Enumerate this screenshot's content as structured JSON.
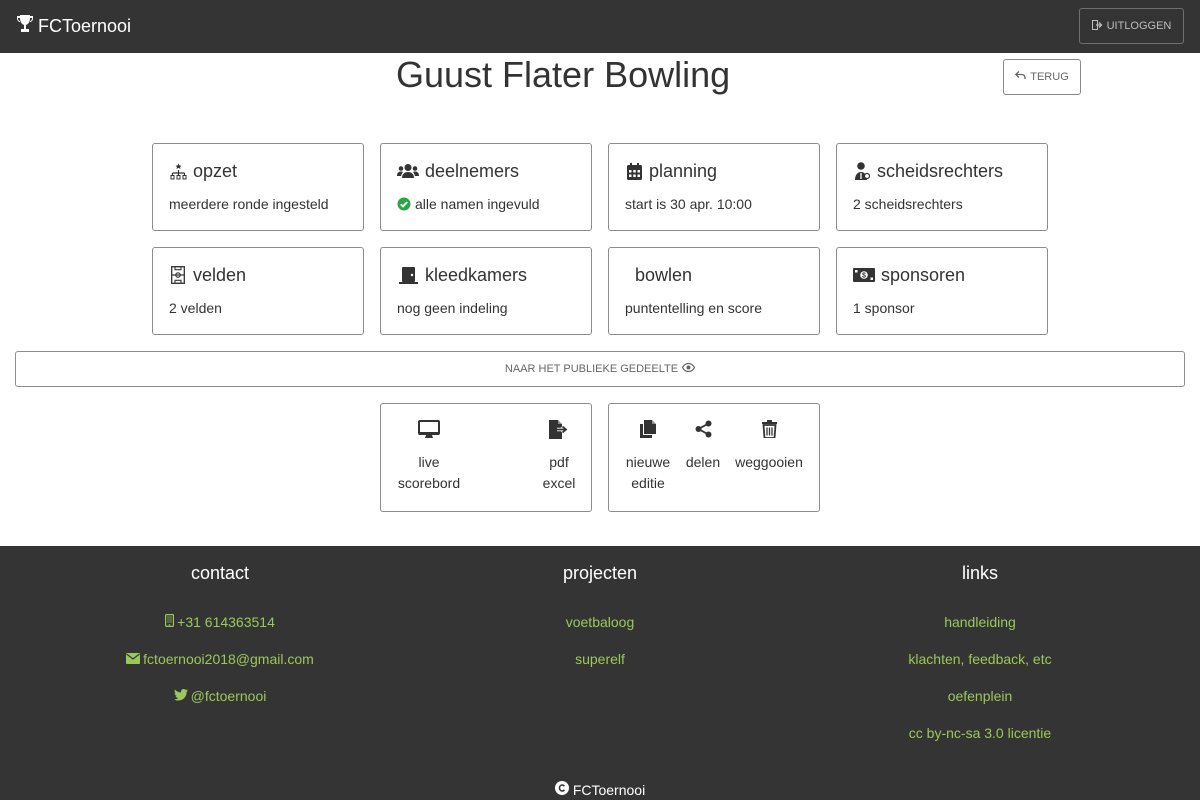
{
  "app": {
    "brand": "FCToernooi",
    "logout_label": "uitloggen"
  },
  "tournament": {
    "title": "Guust Flater Bowling",
    "back_label": "terug"
  },
  "cards": [
    {
      "title": "opzet",
      "subtitle": "meerdere ronde ingesteld",
      "icon": "sitemap-icon"
    },
    {
      "title": "deelnemers",
      "subtitle": "alle namen ingevuld",
      "icon": "users-icon",
      "status_icon": "check-circle-icon"
    },
    {
      "title": "planning",
      "subtitle": "start is 30 apr. 10:00",
      "icon": "calendar-icon"
    },
    {
      "title": "scheidsrechters",
      "subtitle": "2 scheidsrechters",
      "icon": "referee-icon"
    },
    {
      "title": "velden",
      "subtitle": "2 velden",
      "icon": "field-icon"
    },
    {
      "title": "kleedkamers",
      "subtitle": "nog geen indeling",
      "icon": "door-icon"
    },
    {
      "title": "bowlen",
      "subtitle": "puntentelling en score",
      "icon": "bowling-icon"
    },
    {
      "title": "sponsoren",
      "subtitle": "1 sponsor",
      "icon": "money-icon"
    }
  ],
  "public_link_label": "naar het publieke gedeelte",
  "actions_left": [
    {
      "label_line1": "live",
      "label_line2": "scorebord",
      "icon": "monitor-icon"
    },
    {
      "label_line1": "pdf",
      "label_line2": "excel",
      "icon": "file-export-icon"
    }
  ],
  "actions_right": [
    {
      "label_line1": "nieuwe",
      "label_line2": "editie",
      "icon": "copy-icon"
    },
    {
      "label_line1": "delen",
      "label_line2": "",
      "icon": "share-icon"
    },
    {
      "label_line1": "weggooien",
      "label_line2": "",
      "icon": "trash-icon"
    }
  ],
  "footer": {
    "contact": {
      "title": "contact",
      "phone": "+31 614363514",
      "email": "fctoernooi2018@gmail.com",
      "twitter": "@fctoernooi"
    },
    "projects": {
      "title": "projecten",
      "items": [
        "voetbaloog",
        "superelf"
      ]
    },
    "links": {
      "title": "links",
      "items": [
        "handleiding",
        "klachten, feedback, etc",
        "oefenplein",
        "cc by-nc-sa 3.0 licentie"
      ]
    },
    "copyright": "FCToernooi"
  },
  "colors": {
    "navbar_bg": "#343434",
    "footer_bg": "#343434",
    "link_green": "#9bc85a",
    "check_green": "#28a745"
  }
}
